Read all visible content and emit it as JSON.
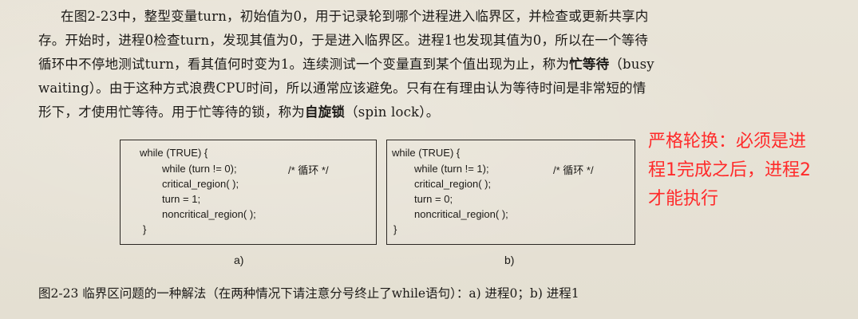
{
  "paragraph": {
    "line1": "在图2-23中，整型变量turn，初始值为0，用于记录轮到哪个进程进入临界区，并检查或更新共享内",
    "line2": "存。开始时，进程0检查turn，发现其值为0，于是进入临界区。进程1也发现其值为0，所以在一个等待",
    "line3": "循环中不停地测试turn，看其值何时变为1。连续测试一个变量直到某个值出现为止，称为",
    "line3_bold": "忙等待",
    "line3_tail": "（busy",
    "line4": "waiting）。由于这种方式浪费CPU时间，所以通常应该避免。只有在有理由认为等待时间是非常短的情",
    "line5_pre": "形下，才使用忙等待。用于忙等待的锁，称为",
    "line5_bold": "自旋锁",
    "line5_tail": "（spin lock）。"
  },
  "annotation": {
    "line1": "严格轮换：必须是进",
    "line2": "程1完成之后，进程2",
    "line3": "才能执行"
  },
  "figure": {
    "a": {
      "line1": "while (TRUE) {",
      "line2": "while (turn != 0);",
      "comment": "/* 循环 */",
      "line3": "critical_region( );",
      "line4": "turn = 1;",
      "line5": "noncritical_region( );",
      "line6": "}",
      "label": "a)"
    },
    "b": {
      "line1": "while (TRUE) {",
      "line2": "while (turn != 1);",
      "comment": "/* 循环 */",
      "line3": "critical_region( );",
      "line4": "turn = 0;",
      "line5": "noncritical_region( );",
      "line6": "}",
      "label": "b)"
    }
  },
  "caption": "图2-23  临界区问题的一种解法（在两种情况下请注意分号终止了while语句）：a) 进程0；b) 进程1"
}
